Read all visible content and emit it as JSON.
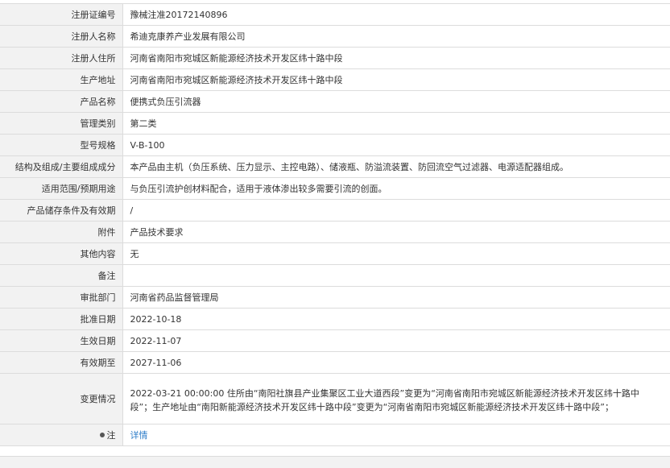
{
  "rows": [
    {
      "label": "注册证编号",
      "value": "豫械注准20172140896"
    },
    {
      "label": "注册人名称",
      "value": "希迪克康养产业发展有限公司"
    },
    {
      "label": "注册人住所",
      "value": "河南省南阳市宛城区新能源经济技术开发区纬十路中段"
    },
    {
      "label": "生产地址",
      "value": "河南省南阳市宛城区新能源经济技术开发区纬十路中段"
    },
    {
      "label": "产品名称",
      "value": "便携式负压引流器"
    },
    {
      "label": "管理类别",
      "value": "第二类"
    },
    {
      "label": "型号规格",
      "value": "V-B-100"
    },
    {
      "label": "结构及组成/主要组成成分",
      "value": "本产品由主机（负压系统、压力显示、主控电路）、储液瓶、防溢流装置、防回流空气过滤器、电源适配器组成。"
    },
    {
      "label": "适用范围/预期用途",
      "value": "与负压引流护创材料配合，适用于液体渗出较多需要引流的创面。"
    },
    {
      "label": "产品储存条件及有效期",
      "value": "/"
    },
    {
      "label": "附件",
      "value": "产品技术要求"
    },
    {
      "label": "其他内容",
      "value": "无"
    },
    {
      "label": "备注",
      "value": ""
    },
    {
      "label": "审批部门",
      "value": "河南省药品监督管理局"
    },
    {
      "label": "批准日期",
      "value": "2022-10-18"
    },
    {
      "label": "生效日期",
      "value": "2022-11-07"
    },
    {
      "label": "有效期至",
      "value": "2027-11-06"
    },
    {
      "label": "变更情况",
      "value": "2022-03-21 00:00:00 住所由“南阳社旗县产业集聚区工业大道西段”变更为“河南省南阳市宛城区新能源经济技术开发区纬十路中段”；生产地址由“南阳新能源经济技术开发区纬十路中段”变更为“河南省南阳市宛城区新能源经济技术开发区纬十路中段”；"
    }
  ],
  "note_row": {
    "label": "注",
    "link_text": "详情"
  }
}
